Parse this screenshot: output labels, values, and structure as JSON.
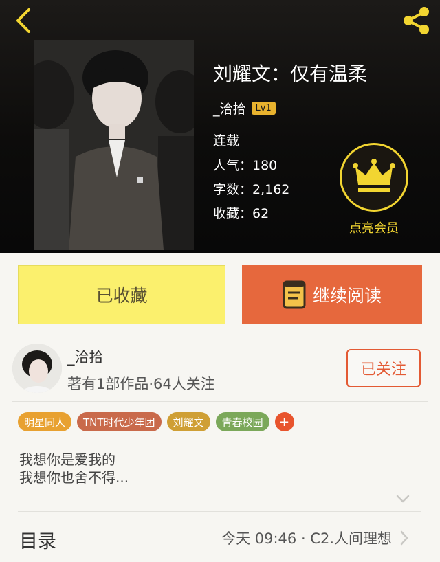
{
  "header": {
    "title": "刘耀文：仅有温柔",
    "author": "_洽拾",
    "level": "Lv1",
    "status": "连载",
    "popularity": "人气：180",
    "word_count": "字数：2,162",
    "favorites": "收藏：62",
    "vip_label": "点亮会员"
  },
  "actions": {
    "favorite_label": "已收藏",
    "read_label": "继续阅读"
  },
  "author_row": {
    "name": "_洽拾",
    "meta": "著有1部作品·64人关注",
    "follow_label": "已关注"
  },
  "tags": [
    {
      "label": "明星同人",
      "color": "#e8a131"
    },
    {
      "label": "TNT时代少年团",
      "color": "#c96a4b"
    },
    {
      "label": "刘耀文",
      "color": "#cf9f35"
    },
    {
      "label": "青春校园",
      "color": "#7ba85a"
    }
  ],
  "tag_add": "+",
  "synopsis": {
    "line1": "我想你是爱我的",
    "line2": "我想你也舍不得..."
  },
  "toc": {
    "label": "目录",
    "latest": "今天 09:46 · C2.人间理想"
  },
  "colors": {
    "accent_orange": "#e6683d",
    "accent_yellow": "#fbf06d",
    "vip_gold": "#f2d531"
  },
  "icons": [
    "back-icon",
    "share-icon",
    "crown-icon",
    "book-icon",
    "chevron-down-icon",
    "chevron-right-icon"
  ]
}
